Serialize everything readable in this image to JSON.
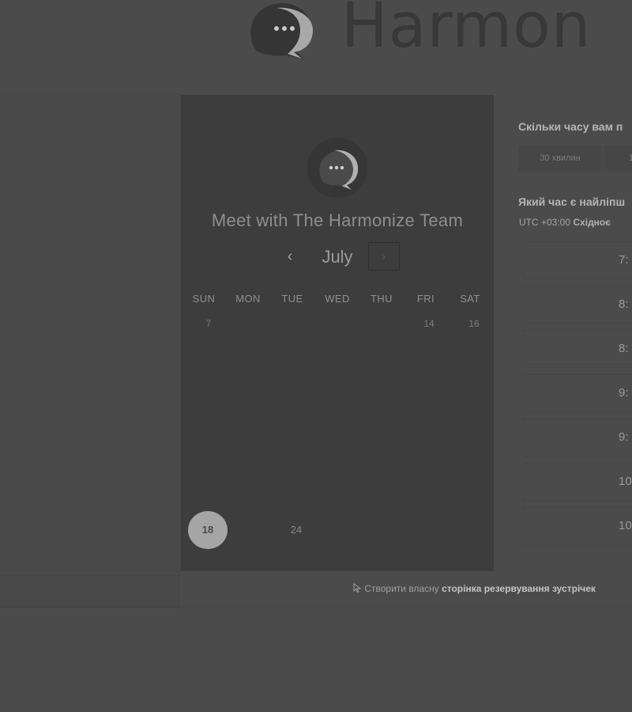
{
  "header": {
    "brand": "Harmon"
  },
  "calendar": {
    "title": "Meet with The Harmonize Team",
    "month": "July",
    "prev_icon": "chevron-left-icon",
    "next_icon": "chevron-right-icon",
    "prev_symbol": "‹",
    "next_symbol": "›",
    "weekdays": [
      "SUN",
      "MON",
      "TUE",
      "WED",
      "THU",
      "FRI",
      "SAT"
    ],
    "days_visible": [
      {
        "label": "7"
      },
      {
        "label": "14"
      },
      {
        "label": "16"
      },
      {
        "label": "24"
      }
    ],
    "selected_day": "18"
  },
  "booking": {
    "duration_question": "Скільки часу вам п",
    "duration_options": [
      "30 хвилин",
      "1"
    ],
    "time_question": "Який час є найліпш",
    "timezone_offset": "UTC +03:00",
    "timezone_name": "Східноє",
    "slots": [
      "7:",
      "8:",
      "8:",
      "9:",
      "9:",
      "10:",
      "10:"
    ]
  },
  "footer": {
    "prefix": "Створити власну",
    "link": "сторінка резервування зустрічек"
  },
  "colors": {
    "accent": "#a5a5a5",
    "panel": "#3d3d3d",
    "background": "#4b4b4b"
  }
}
